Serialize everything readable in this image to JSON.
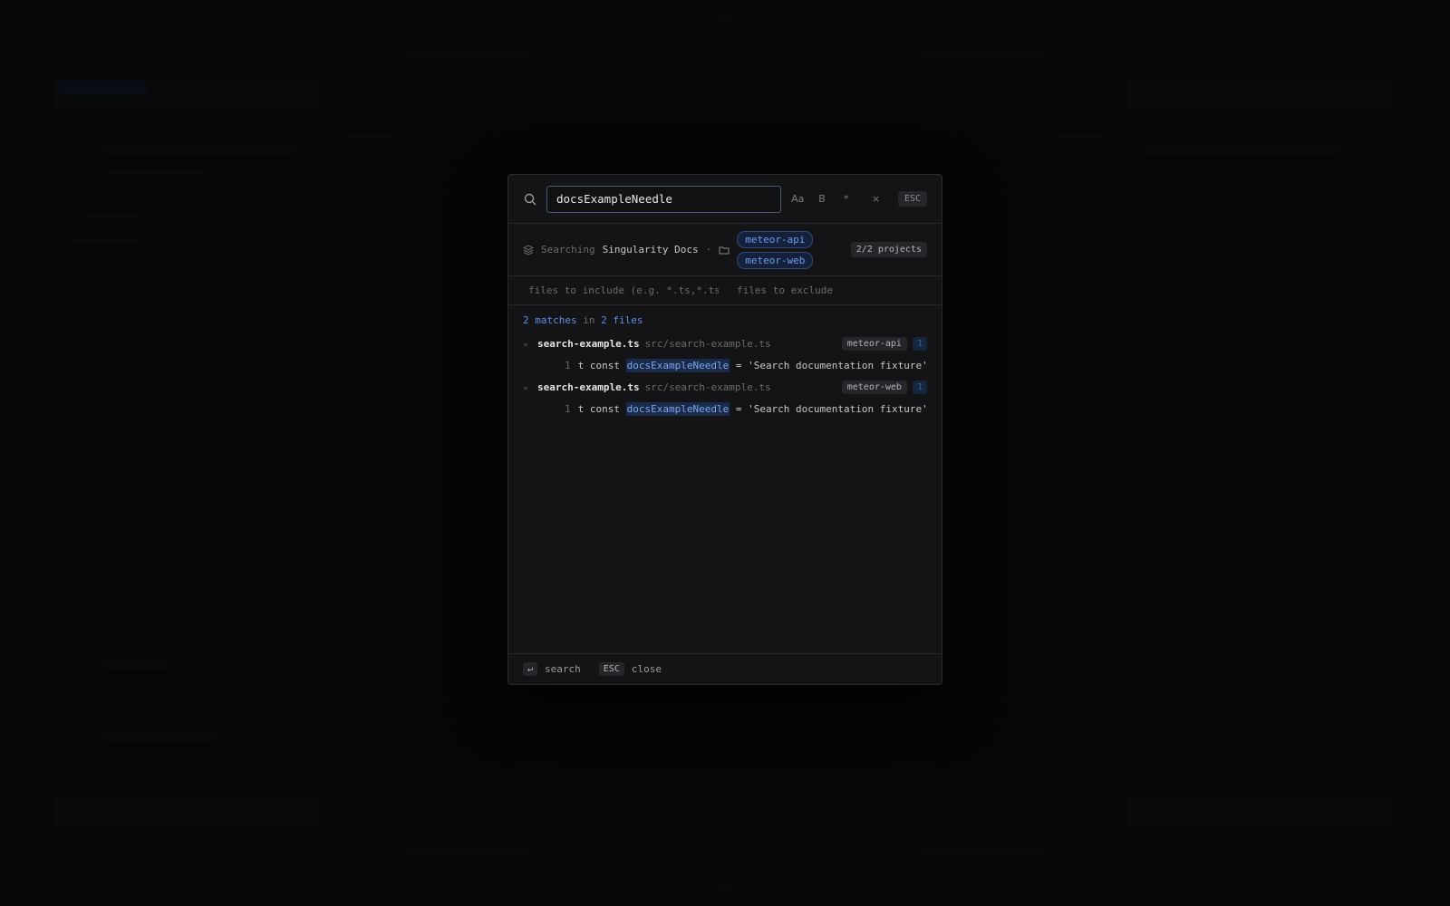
{
  "search": {
    "query": "docsExampleNeedle",
    "options": [
      "Aa",
      "B",
      "*",
      "×"
    ],
    "esc_label": "ESC"
  },
  "scope": {
    "searching_label": "Searching",
    "workspace": "Singularity Docs",
    "separator": "·",
    "projects": [
      "meteor-api",
      "meteor-web"
    ],
    "project_count": "2/2 projects"
  },
  "filters": {
    "include_placeholder": "files to include (e.g. *.ts,*.tsx)",
    "exclude_placeholder": "files to exclude"
  },
  "summary": {
    "matches": "2",
    "matches_label": "matches",
    "in_label": "in",
    "files": "2",
    "files_label": "files"
  },
  "results": [
    {
      "filename": "search-example.ts",
      "path": "src/search-example.ts",
      "project": "meteor-api",
      "hits": "1",
      "line": "1",
      "before": "t const ",
      "match": "docsExampleNeedle",
      "after": " = 'Search documentation fixture'"
    },
    {
      "filename": "search-example.ts",
      "path": "src/search-example.ts",
      "project": "meteor-web",
      "hits": "1",
      "line": "1",
      "before": "t const ",
      "match": "docsExampleNeedle",
      "after": " = 'Search documentation fixture'"
    }
  ],
  "footer": {
    "enter_key": "↵",
    "enter_label": "search",
    "esc_key": "ESC",
    "esc_label": "close"
  }
}
